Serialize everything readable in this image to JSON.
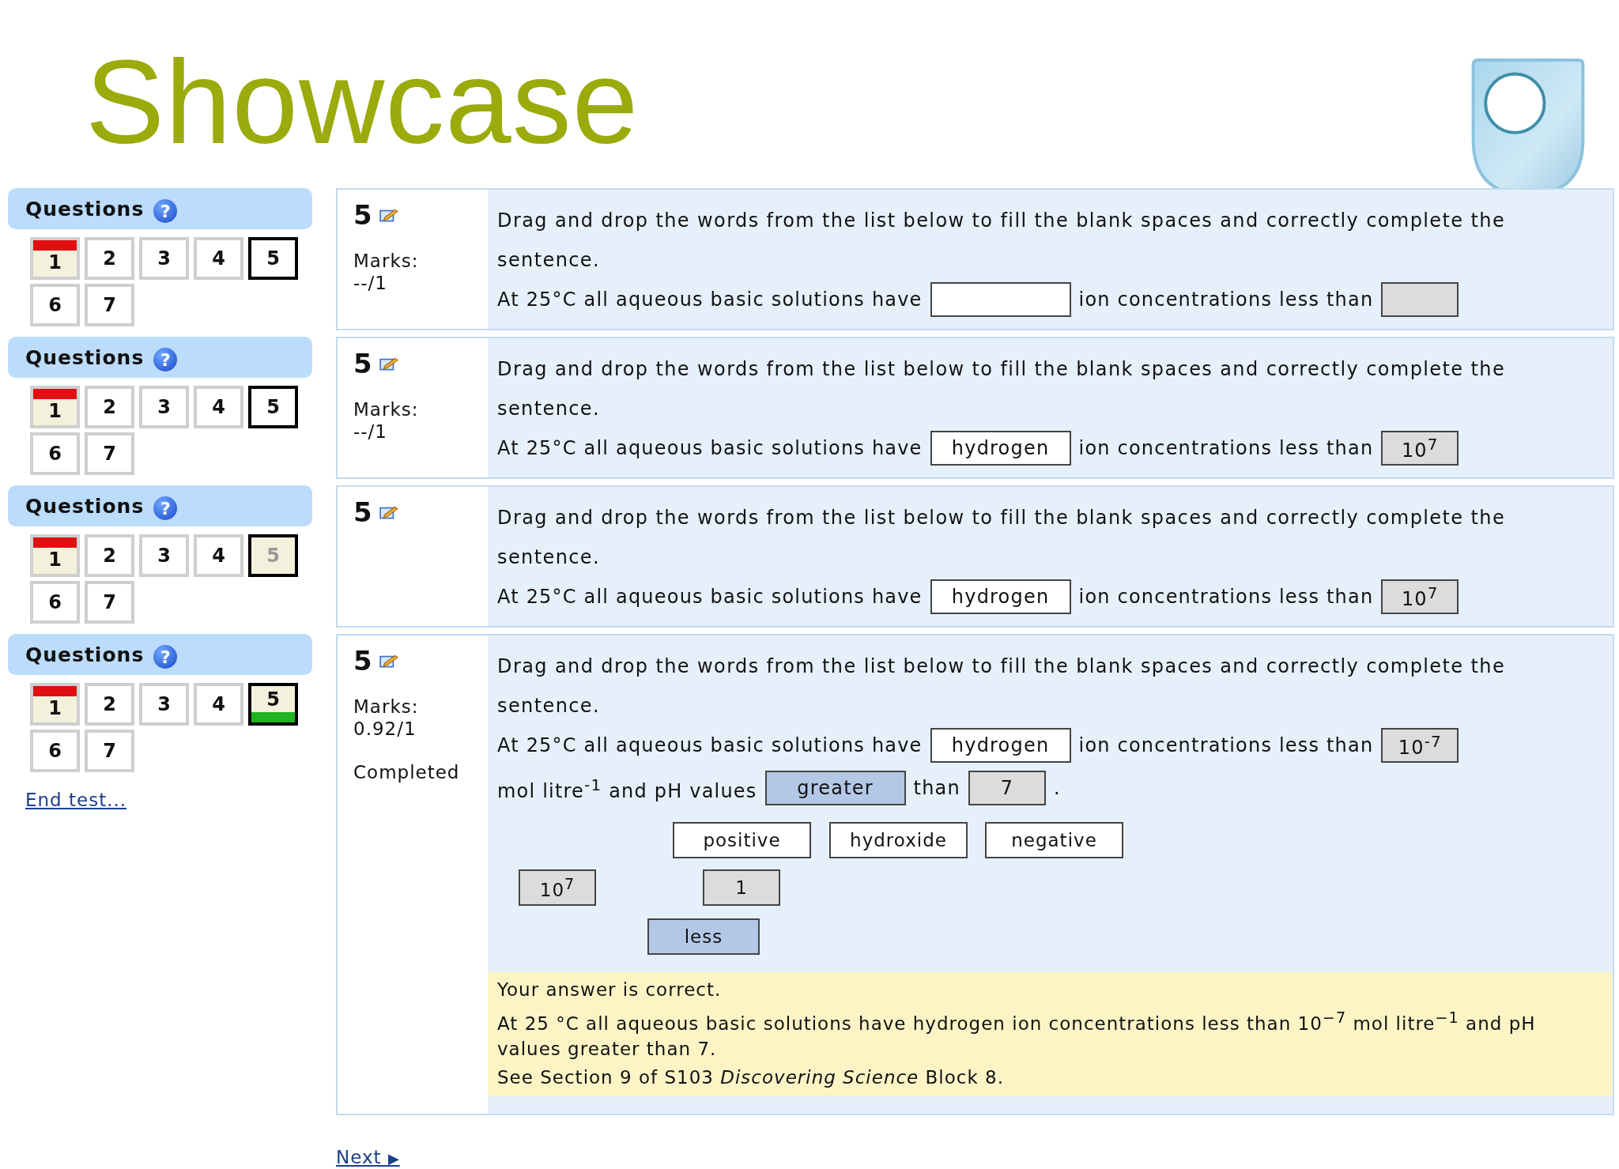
{
  "title": "Showcase",
  "snapshots": [
    {
      "sidebar": {
        "heading": "Questions",
        "help": "?",
        "buttons": [
          {
            "label": "1",
            "selected": false,
            "flagged": true,
            "correct": false,
            "dimmed": false
          },
          {
            "label": "2",
            "selected": false,
            "flagged": false,
            "correct": false,
            "dimmed": false
          },
          {
            "label": "3",
            "selected": false,
            "flagged": false,
            "correct": false,
            "dimmed": false
          },
          {
            "label": "4",
            "selected": false,
            "flagged": false,
            "correct": false,
            "dimmed": false
          },
          {
            "label": "5",
            "selected": true,
            "flagged": false,
            "correct": false,
            "dimmed": false
          },
          {
            "label": "6",
            "selected": false,
            "flagged": false,
            "correct": false,
            "dimmed": false
          },
          {
            "label": "7",
            "selected": false,
            "flagged": false,
            "correct": false,
            "dimmed": false
          }
        ]
      },
      "question": {
        "number": "5",
        "marks_label": "Marks:",
        "marks": "--/1",
        "prompt": "Drag and drop the words from the list below to fill the blank spaces and correctly complete the sentence.",
        "sentence": [
          {
            "kind": "text",
            "text": "At 25°C all aqueous basic solutions have"
          },
          {
            "kind": "word-slot",
            "highlighted": false
          },
          {
            "kind": "text",
            "text": "ion concentrations less than"
          },
          {
            "kind": "number-slot",
            "highlighted": false
          }
        ]
      }
    },
    {
      "sidebar": {
        "heading": "Questions",
        "help": "?",
        "buttons": [
          {
            "label": "1",
            "selected": false,
            "flagged": true,
            "correct": false,
            "dimmed": false
          },
          {
            "label": "2",
            "selected": false,
            "flagged": false,
            "correct": false,
            "dimmed": false
          },
          {
            "label": "3",
            "selected": false,
            "flagged": false,
            "correct": false,
            "dimmed": false
          },
          {
            "label": "4",
            "selected": false,
            "flagged": false,
            "correct": false,
            "dimmed": false
          },
          {
            "label": "5",
            "selected": true,
            "flagged": false,
            "correct": false,
            "dimmed": false
          },
          {
            "label": "6",
            "selected": false,
            "flagged": false,
            "correct": false,
            "dimmed": false
          },
          {
            "label": "7",
            "selected": false,
            "flagged": false,
            "correct": false,
            "dimmed": false
          }
        ]
      },
      "question": {
        "number": "5",
        "marks_label": "Marks:",
        "marks": "--/1",
        "prompt": "Drag and drop the words from the list below to fill the blank spaces and correctly complete the sentence.",
        "sentence": [
          {
            "kind": "text",
            "text": "At 25°C all aqueous basic solutions have"
          },
          {
            "kind": "word-slot",
            "highlighted": false,
            "text": "hydrogen"
          },
          {
            "kind": "text",
            "text": "ion concentrations less than"
          },
          {
            "kind": "number-slot",
            "highlighted": false,
            "text": "10$^{7}$"
          }
        ]
      }
    },
    {
      "sidebar": {
        "heading": "Questions",
        "help": "?",
        "buttons": [
          {
            "label": "1",
            "selected": false,
            "flagged": true,
            "correct": false,
            "dimmed": false
          },
          {
            "label": "2",
            "selected": false,
            "flagged": false,
            "correct": false,
            "dimmed": false
          },
          {
            "label": "3",
            "selected": false,
            "flagged": false,
            "correct": false,
            "dimmed": false
          },
          {
            "label": "4",
            "selected": false,
            "flagged": false,
            "correct": false,
            "dimmed": false
          },
          {
            "label": "5",
            "selected": true,
            "flagged": false,
            "correct": false,
            "dimmed": true
          },
          {
            "label": "6",
            "selected": false,
            "flagged": false,
            "correct": false,
            "dimmed": false
          },
          {
            "label": "7",
            "selected": false,
            "flagged": false,
            "correct": false,
            "dimmed": false
          }
        ]
      },
      "question": {
        "number": "5",
        "prompt": "Drag and drop the words from the list below to fill the blank spaces and correctly complete the sentence.",
        "sentence": [
          {
            "kind": "text",
            "text": "At 25°C all aqueous basic solutions have"
          },
          {
            "kind": "word-slot",
            "highlighted": false,
            "text": "hydrogen"
          },
          {
            "kind": "text",
            "text": "ion concentrations less than"
          },
          {
            "kind": "number-slot",
            "highlighted": false,
            "text": "10$^{7}$"
          }
        ]
      }
    },
    {
      "sidebar": {
        "heading": "Questions",
        "help": "?",
        "buttons": [
          {
            "label": "1",
            "selected": false,
            "flagged": true,
            "correct": false,
            "dimmed": false
          },
          {
            "label": "2",
            "selected": false,
            "flagged": false,
            "correct": false,
            "dimmed": false
          },
          {
            "label": "3",
            "selected": false,
            "flagged": false,
            "correct": false,
            "dimmed": false
          },
          {
            "label": "4",
            "selected": false,
            "flagged": false,
            "correct": false,
            "dimmed": false
          },
          {
            "label": "5",
            "selected": true,
            "flagged": false,
            "correct": true,
            "dimmed": false
          },
          {
            "label": "6",
            "selected": false,
            "flagged": false,
            "correct": false,
            "dimmed": false
          },
          {
            "label": "7",
            "selected": false,
            "flagged": false,
            "correct": false,
            "dimmed": false
          }
        ],
        "end_link": "End test..."
      },
      "question": {
        "number": "5",
        "marks_label": "Marks:",
        "marks": "0.92/1",
        "state": "Completed",
        "prompt": "Drag and drop the words from the list below to fill the blank spaces and correctly complete the sentence.",
        "sentence": [
          {
            "kind": "text",
            "text": "At 25°C all aqueous basic solutions have"
          },
          {
            "kind": "word-slot",
            "highlighted": false,
            "text": "hydrogen"
          },
          {
            "kind": "text",
            "text": "ion concentrations less than"
          },
          {
            "kind": "number-slot",
            "highlighted": false,
            "text": "10$^{-7}$"
          },
          {
            "kind": "text",
            "text": "mol litre$^{-1}$ and pH values"
          },
          {
            "kind": "word-slot",
            "highlighted": true,
            "text": "greater"
          },
          {
            "kind": "text",
            "text": "than"
          },
          {
            "kind": "number-slot",
            "highlighted": false,
            "text": "7"
          },
          {
            "kind": "text",
            "text": "."
          }
        ],
        "word_bank": [
          {
            "text": "positive",
            "kind": "word",
            "highlighted": false
          },
          {
            "text": "hydroxide",
            "kind": "word",
            "highlighted": false
          },
          {
            "text": "negative",
            "kind": "word",
            "highlighted": false
          },
          {
            "text": "10$^{7}$",
            "kind": "number",
            "highlighted": false
          },
          {
            "text": "1",
            "kind": "number",
            "highlighted": false
          },
          {
            "text": "less",
            "kind": "word",
            "highlighted": true
          }
        ],
        "feedback": [
          "Your answer is correct.",
          "At 25 °C all aqueous basic solutions have hydrogen ion concentrations less than 10$^{−7}$ mol litre$^{−1}$ and pH values greater than 7.",
          "See Section 9 of S103 *Discovering Science* Block 8."
        ]
      }
    }
  ],
  "next_link": {
    "text": "Next",
    "arrow": "▶"
  }
}
